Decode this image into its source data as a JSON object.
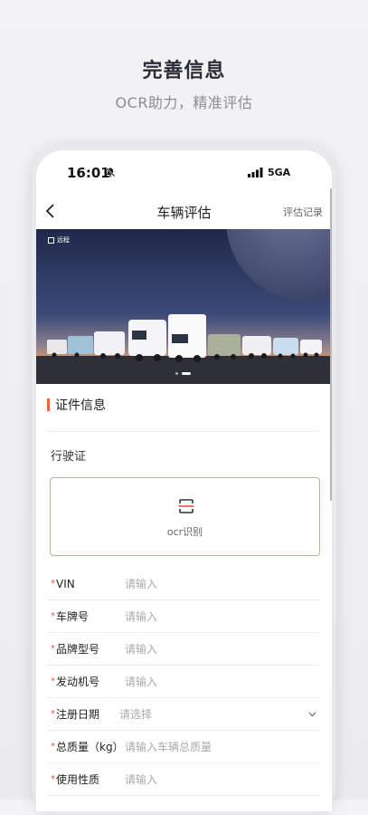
{
  "promo": {
    "title": "完善信息",
    "subtitle": "OCR助力，精准评估"
  },
  "status": {
    "time": "16:01",
    "network": "5GA"
  },
  "nav": {
    "title": "车辆评估",
    "action": "评估记录"
  },
  "banner": {
    "brand": "远程",
    "slides": 2,
    "active_slide": 2
  },
  "section": {
    "title": "证件信息",
    "accent_color": "#e8663d"
  },
  "document": {
    "label": "行驶证"
  },
  "ocr": {
    "label": "ocr识别",
    "border_color": "#d9a88a"
  },
  "fields": [
    {
      "label": "VIN",
      "placeholder": "请输入",
      "required": true,
      "type": "input"
    },
    {
      "label": "车牌号",
      "placeholder": "请输入",
      "required": true,
      "type": "input"
    },
    {
      "label": "品牌型号",
      "placeholder": "请输入",
      "required": true,
      "type": "input"
    },
    {
      "label": "发动机号",
      "placeholder": "请输入",
      "required": true,
      "type": "input"
    },
    {
      "label": "注册日期",
      "placeholder": "请选择",
      "required": true,
      "type": "select"
    },
    {
      "label": "总质量（kg）",
      "placeholder": "请输入车辆总质量",
      "required": true,
      "type": "input"
    },
    {
      "label": "使用性质",
      "placeholder": "请输入",
      "required": true,
      "type": "input"
    }
  ],
  "required_mark": "*",
  "icons": [
    "mute-bell-icon",
    "signal-icon",
    "back-arrow-icon",
    "scan-icon",
    "chevron-down-icon"
  ]
}
